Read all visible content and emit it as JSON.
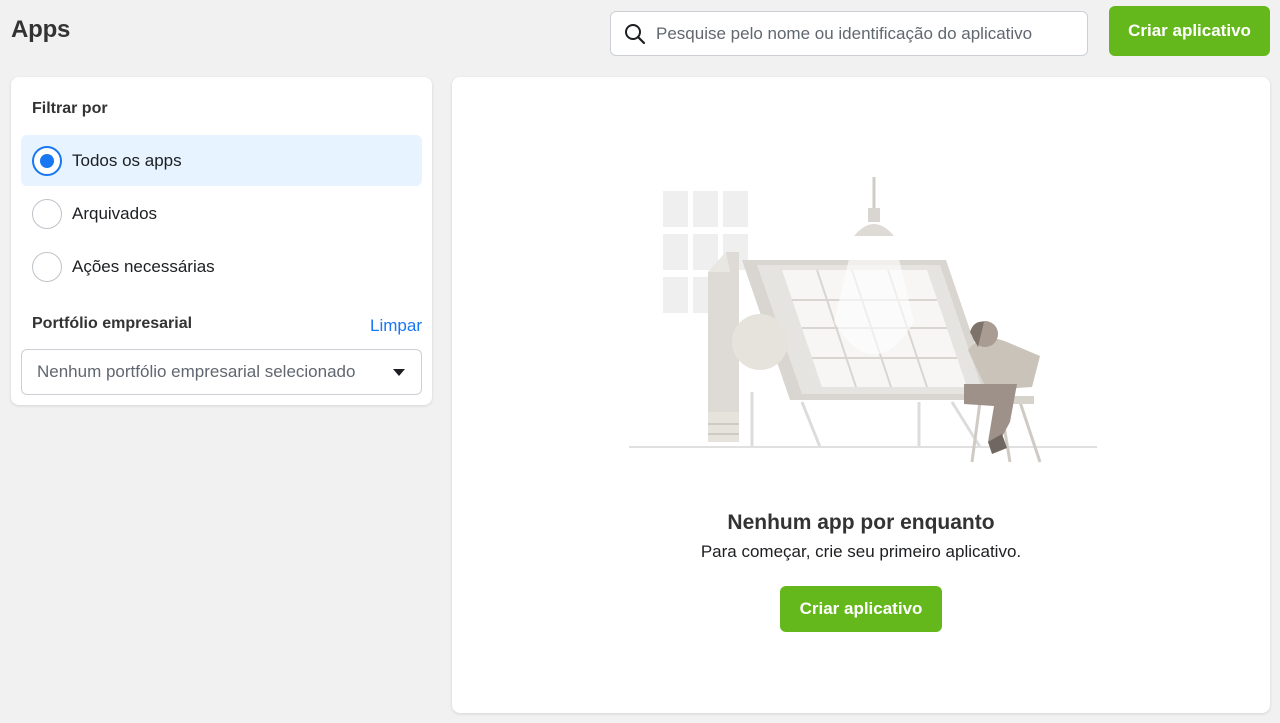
{
  "header": {
    "title": "Apps",
    "search_placeholder": "Pesquise pelo nome ou identificação do aplicativo",
    "search_value": "",
    "create_button_label": "Criar aplicativo"
  },
  "filter": {
    "title": "Filtrar por",
    "options": [
      {
        "label": "Todos os apps",
        "selected": true
      },
      {
        "label": "Arquivados",
        "selected": false
      },
      {
        "label": "Ações necessárias",
        "selected": false
      }
    ],
    "portfolio": {
      "label": "Portfólio empresarial",
      "clear_label": "Limpar",
      "selected_value": "Nenhum portfólio empresarial selecionado"
    }
  },
  "empty_state": {
    "title": "Nenhum app por enquanto",
    "subtitle": "Para começar, crie seu primeiro aplicativo.",
    "button_label": "Criar aplicativo"
  },
  "colors": {
    "accent_green": "#65b81b",
    "link_blue": "#1877f2",
    "selected_bg": "#e7f3ff",
    "page_bg": "#f1f1f1"
  }
}
